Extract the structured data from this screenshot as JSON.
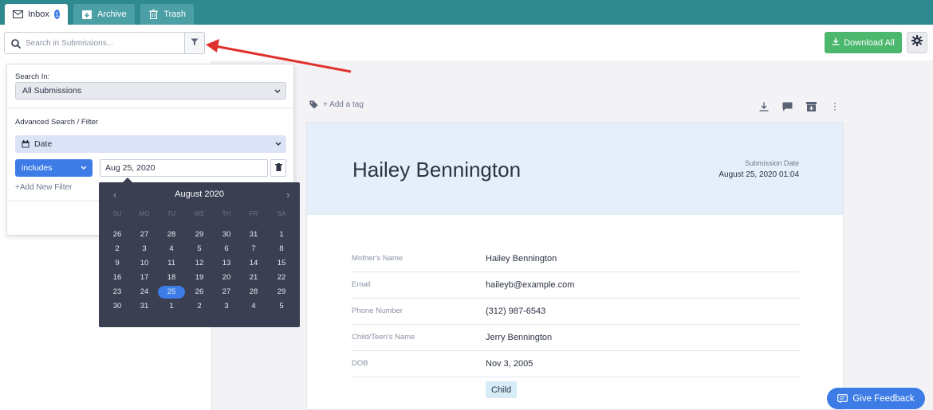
{
  "tabs": [
    {
      "label": "Inbox",
      "icon": "mail-icon",
      "badge": "1",
      "active": true
    },
    {
      "label": "Archive",
      "icon": "archive-icon"
    },
    {
      "label": "Trash",
      "icon": "trash-icon"
    }
  ],
  "search": {
    "placeholder": "Search in Submissions..."
  },
  "header": {
    "download_label": "Download All"
  },
  "filter_panel": {
    "search_in_label": "Search In:",
    "search_in_value": "All Submissions",
    "advanced_label": "Advanced Search / Filter",
    "field_value": "Date",
    "operator_value": "includes",
    "date_value": "Aug 25, 2020",
    "add_filter": "+Add New Filter"
  },
  "calendar": {
    "month": "August 2020",
    "prev": "‹",
    "next": "›",
    "dow": [
      "SU",
      "MO",
      "TU",
      "WE",
      "TH",
      "FR",
      "SA"
    ],
    "weeks": [
      [
        "26",
        "27",
        "28",
        "29",
        "30",
        "31",
        "1"
      ],
      [
        "2",
        "3",
        "4",
        "5",
        "6",
        "7",
        "8"
      ],
      [
        "9",
        "10",
        "11",
        "12",
        "13",
        "14",
        "15"
      ],
      [
        "16",
        "17",
        "18",
        "19",
        "20",
        "21",
        "22"
      ],
      [
        "23",
        "24",
        "25",
        "26",
        "27",
        "28",
        "29"
      ],
      [
        "30",
        "31",
        "1",
        "2",
        "3",
        "4",
        "5"
      ]
    ],
    "selected": "25"
  },
  "submission": {
    "tag_label": "+ Add a tag",
    "name": "Hailey Bennington",
    "date_label": "Submission Date",
    "date_value": "August 25, 2020 01:04",
    "fields": [
      {
        "label": "Mother's Name",
        "value": "Hailey Bennington"
      },
      {
        "label": "Email",
        "value": "haileyb@example.com"
      },
      {
        "label": "Phone Number",
        "value": "(312) 987-6543"
      },
      {
        "label": "Child/Teen's Name",
        "value": "Jerry Bennington"
      },
      {
        "label": "DOB",
        "value": "Nov 3, 2005"
      }
    ],
    "chip": "Child"
  },
  "feedback": {
    "label": "Give Feedback"
  },
  "colors": {
    "topbar": "#2f8a8f",
    "accent": "#3d7ce6",
    "download": "#4bb86e",
    "arrow": "#e0322d"
  }
}
